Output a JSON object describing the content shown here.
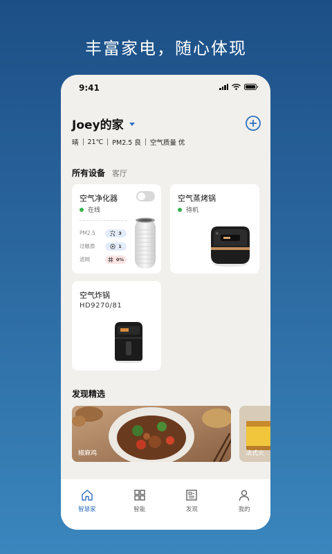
{
  "headline": "丰富家电，随心体现",
  "status_bar": {
    "time": "9:41"
  },
  "home": {
    "title": "Joey的家"
  },
  "weather": [
    "晴",
    "21℃",
    "PM2.5 良",
    "空气质量 优"
  ],
  "devices_section": {
    "title": "所有设备",
    "room": "客厅"
  },
  "devices": [
    {
      "name": "空气净化器",
      "status": "在线",
      "power_on": false,
      "stats": [
        {
          "label": "PM2.5",
          "icon": "particles-icon",
          "value": "3"
        },
        {
          "label": "过敏原",
          "icon": "allergen-icon",
          "value": "1"
        },
        {
          "label": "滤网",
          "icon": "filter-icon",
          "value": "0%"
        }
      ]
    },
    {
      "name": "空气蒸烤锅",
      "status": "待机"
    },
    {
      "name": "空气炸锅",
      "model": "HD9270/81"
    }
  ],
  "discover": {
    "title": "发现精选",
    "recipes": [
      "椒麻鸡",
      "法式火"
    ]
  },
  "tabs": [
    {
      "label": "智慧家",
      "icon": "home-icon",
      "active": true
    },
    {
      "label": "智能",
      "icon": "grid-icon",
      "active": false
    },
    {
      "label": "发现",
      "icon": "news-icon",
      "active": false
    },
    {
      "label": "我的",
      "icon": "person-icon",
      "active": false
    }
  ],
  "colors": {
    "accent": "#2f6fc0",
    "online": "#37b24d",
    "background_top": "#1c4f86",
    "background_bottom": "#3a86bd"
  }
}
